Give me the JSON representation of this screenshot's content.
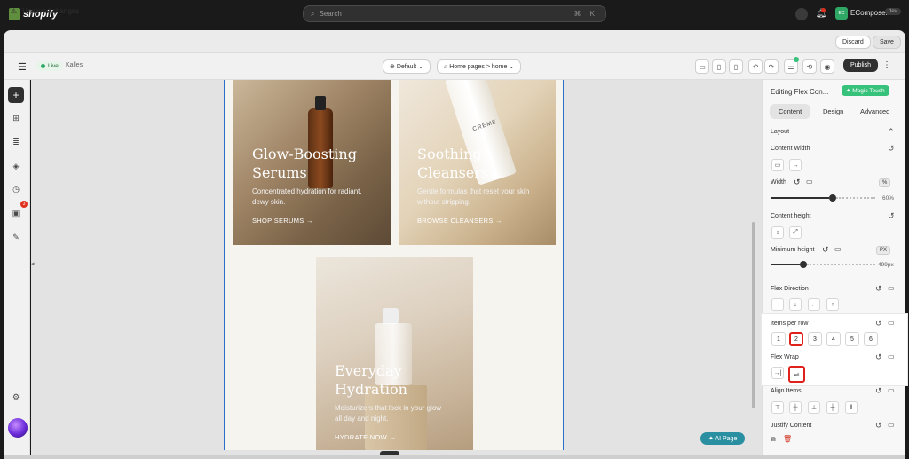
{
  "topbar": {
    "brand": "shopify",
    "search_placeholder": "Search",
    "search_shortcut": "⌘ K",
    "store_badge": "EC",
    "store_name": "EComposer",
    "store_env": "dev"
  },
  "unsaved": {
    "message": "Unsaved changes",
    "discard_label": "Discard",
    "save_label": "Save"
  },
  "toolbar": {
    "live_label": "Live",
    "theme_name": "Kalles",
    "viewport_dropdown": "Default",
    "page_dropdown": "Home pages > home",
    "publish_label": "Publish"
  },
  "canvas": {
    "cards": [
      {
        "title": "Glow-Boosting Serums",
        "text": "Concentrated hydration for radiant, dewy skin.",
        "cta": "SHOP SERUMS →"
      },
      {
        "title": "Soothing Cleansers",
        "text": "Gentle formulas that reset your skin without stripping.",
        "cta": "BROWSE CLEANSERS →",
        "product_label": "CRÈME"
      },
      {
        "title": "Everyday Hydration",
        "text": "Moisturizers that lock in your glow all day and night.",
        "cta": "HYDRATE NOW →"
      }
    ],
    "ai_page_label": "AI Page"
  },
  "rail": {
    "badge_count": "3"
  },
  "panel": {
    "title": "Editing Flex Con...",
    "magic_label": "Magic Touch",
    "tabs": [
      "Content",
      "Design",
      "Advanced"
    ],
    "active_tab": "Content",
    "layout_label": "Layout",
    "content_width_label": "Content Width",
    "width_label": "Width",
    "width_unit": "%",
    "width_value": "60%",
    "width_fraction": 0.6,
    "content_height_label": "Content height",
    "min_height_label": "Minimum height",
    "min_height_unit": "PX",
    "min_height_value": "499px",
    "min_height_fraction": 0.3,
    "flex_direction_label": "Flex Direction",
    "items_per_row_label": "Items per row",
    "items_per_row_options": [
      "1",
      "2",
      "3",
      "4",
      "5",
      "6"
    ],
    "items_per_row_selected": "2",
    "flex_wrap_label": "Flex Wrap",
    "align_items_label": "Align Items",
    "justify_content_label": "Justify Content"
  },
  "colors": {
    "accent_green": "#36c27a",
    "selection_red": "#e0201b",
    "frame_blue": "#2c6ecb"
  }
}
